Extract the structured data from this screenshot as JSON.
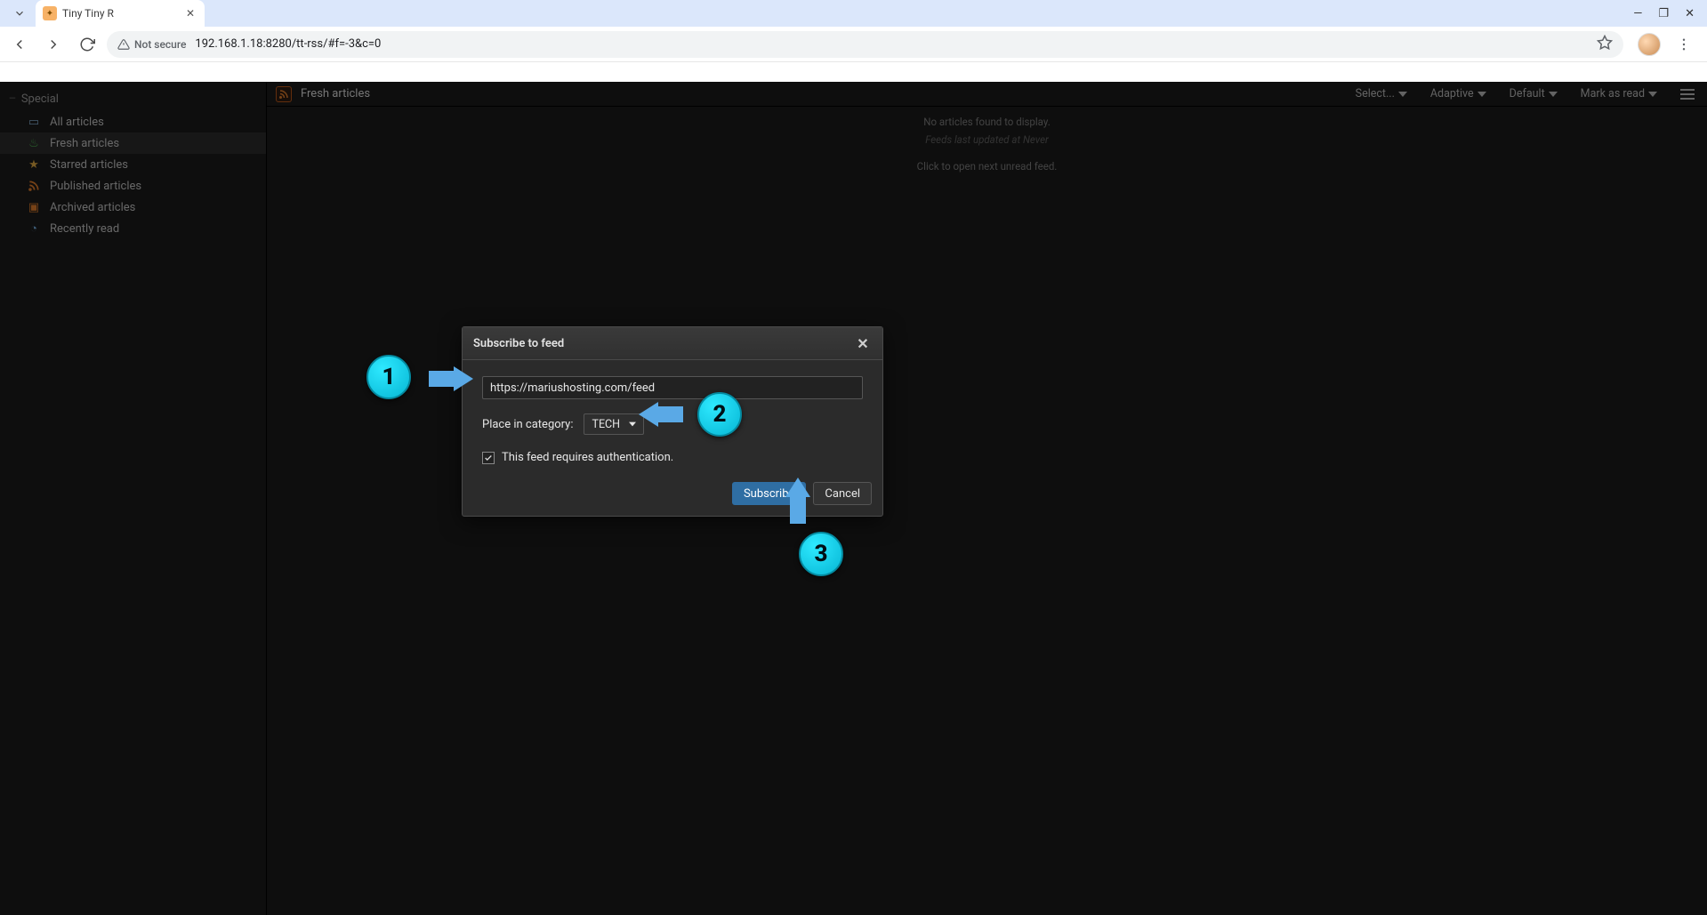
{
  "browser": {
    "tab_title": "Tiny Tiny R",
    "security_label": "Not secure",
    "url": "192.168.1.18:8280/tt-rss/#f=-3&c=0"
  },
  "sidebar": {
    "section": "Special",
    "items": [
      {
        "label": "All articles"
      },
      {
        "label": "Fresh articles"
      },
      {
        "label": "Starred articles"
      },
      {
        "label": "Published articles"
      },
      {
        "label": "Archived articles"
      },
      {
        "label": "Recently read"
      }
    ]
  },
  "header": {
    "feed_title": "Fresh articles",
    "menus": {
      "select": "Select...",
      "mode": "Adaptive",
      "order": "Default",
      "mark": "Mark as read"
    }
  },
  "empty": {
    "line1": "No articles found to display.",
    "line2": "Feeds last updated at Never",
    "line3": "Click to open next unread feed."
  },
  "dialog": {
    "title": "Subscribe to feed",
    "url_value": "https://mariushosting.com/feed",
    "category_label": "Place in category:",
    "category_value": "TECH",
    "auth_label": "This feed requires authentication.",
    "subscribe": "Subscribe",
    "cancel": "Cancel"
  },
  "annotations": {
    "n1": "1",
    "n2": "2",
    "n3": "3"
  }
}
